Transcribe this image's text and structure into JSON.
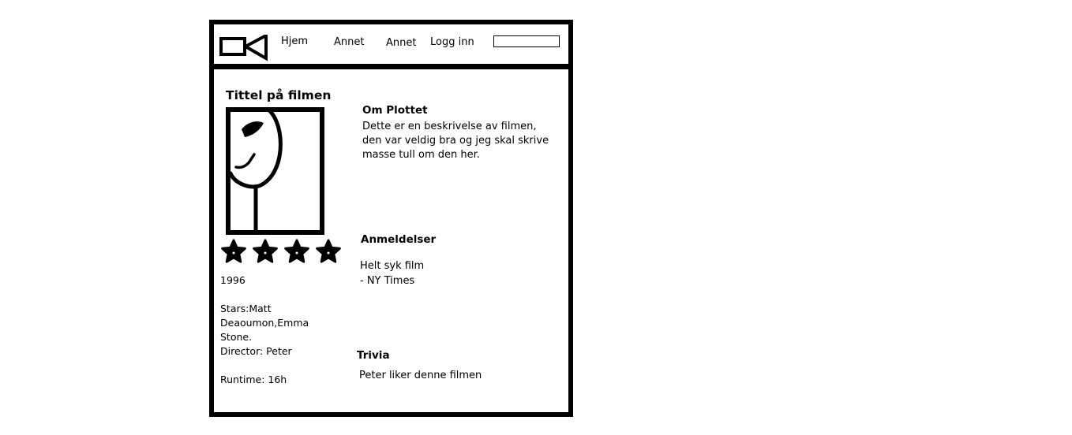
{
  "logo": {
    "icon": "video-camera-icon"
  },
  "nav": {
    "items": [
      {
        "label": "Hjem"
      },
      {
        "label": "Annet"
      },
      {
        "label": "Annet"
      },
      {
        "label": "Logg inn"
      }
    ],
    "search": {
      "value": "",
      "placeholder": ""
    }
  },
  "movie": {
    "title": "Tittel på filmen",
    "poster_icon": "face-drawing-icon",
    "rating": {
      "value": 4,
      "max": 4,
      "icon": "star-icon"
    },
    "year": "1996",
    "stars_line1": "Stars:Matt",
    "stars_line2": "Deaoumon,Emma",
    "stars_line3": "Stone.",
    "director": "Director: Peter",
    "runtime": "Runtime: 16h"
  },
  "plot": {
    "heading": "Om Plottet",
    "line1": "Dette er en beskrivelse av filmen,",
    "line2": "den var veldig bra og jeg skal skrive",
    "line3": "masse tull om den her."
  },
  "reviews": {
    "heading": "Anmeldelser",
    "quote": "Helt syk film",
    "source": "- NY Times"
  },
  "trivia": {
    "heading": "Trivia",
    "text": "Peter liker denne filmen"
  }
}
